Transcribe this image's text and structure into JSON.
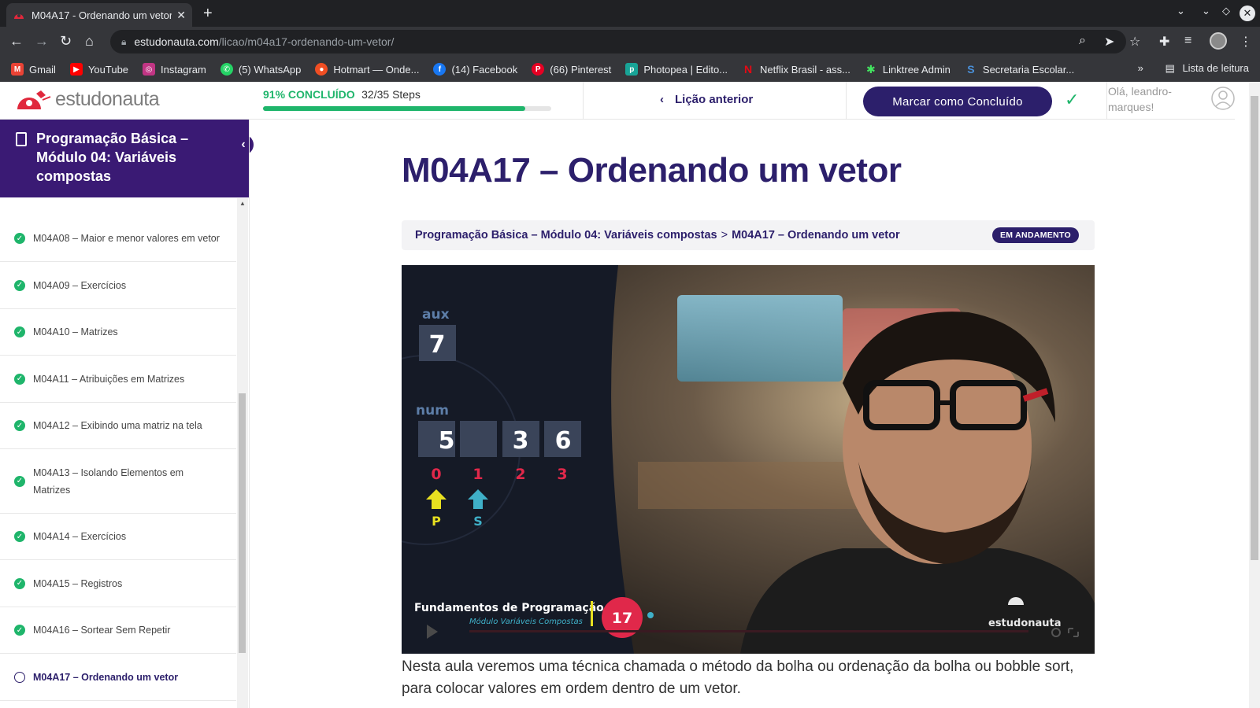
{
  "browser": {
    "tab_title": "M04A17 - Ordenando um vetor",
    "new_tab": "+",
    "url_domain": "estudonauta.com",
    "url_path": "/licao/m04a17-ordenando-um-vetor/",
    "bookmarks": [
      {
        "label": "Gmail",
        "icon": "gmail-icon",
        "color": "#ea4335",
        "glyph": "M"
      },
      {
        "label": "YouTube",
        "icon": "youtube-icon",
        "color": "#ff0000",
        "glyph": "▶"
      },
      {
        "label": "Instagram",
        "icon": "instagram-icon",
        "color": "#c13584",
        "glyph": "◎"
      },
      {
        "label": "(5) WhatsApp",
        "icon": "whatsapp-icon",
        "color": "#25d366",
        "glyph": "✆"
      },
      {
        "label": "Hotmart — Onde...",
        "icon": "hotmart-icon",
        "color": "#f04e23",
        "glyph": "●"
      },
      {
        "label": "(14) Facebook",
        "icon": "facebook-icon",
        "color": "#1877f2",
        "glyph": "f"
      },
      {
        "label": "(66) Pinterest",
        "icon": "pinterest-icon",
        "color": "#e60023",
        "glyph": "P"
      },
      {
        "label": "Photopea | Edito...",
        "icon": "photopea-icon",
        "color": "#18a497",
        "glyph": "p"
      },
      {
        "label": "Netflix Brasil - ass...",
        "icon": "netflix-icon",
        "color": "#e50914",
        "glyph": "N"
      },
      {
        "label": "Linktree Admin",
        "icon": "linktree-icon",
        "color": "#43e660",
        "glyph": "✱"
      },
      {
        "label": "Secretaria Escolar...",
        "icon": "secretaria-icon",
        "color": "#4a90d9",
        "glyph": "S"
      }
    ],
    "more": "»",
    "reading_list": "Lista de leitura"
  },
  "header": {
    "logo_text": "estudonauta",
    "progress_pct": "91% CONCLUÍDO",
    "progress_steps": "32/35 Steps",
    "progress_fraction": 0.91,
    "prev_lesson": "Lição anterior",
    "mark_complete": "Marcar como Concluído",
    "greeting": "Olá, leandro-marques!"
  },
  "sidebar": {
    "course_title": "Programação Básica – Módulo 04: Variáveis compostas",
    "lessons": [
      {
        "label": "M04A08 – Maior e menor valores em vetor",
        "done": true
      },
      {
        "label": "M04A09 – Exercícios",
        "done": true
      },
      {
        "label": "M04A10 – Matrizes",
        "done": true
      },
      {
        "label": "M04A11 – Atribuições em Matrizes",
        "done": true
      },
      {
        "label": "M04A12 – Exibindo uma matriz na tela",
        "done": true
      },
      {
        "label": "M04A13 – Isolando Elementos em Matrizes",
        "done": true
      },
      {
        "label": "M04A14 – Exercícios",
        "done": true
      },
      {
        "label": "M04A15 – Registros",
        "done": true
      },
      {
        "label": "M04A16 – Sortear Sem Repetir",
        "done": true
      },
      {
        "label": "M04A17 – Ordenando um vetor",
        "done": false
      }
    ]
  },
  "main": {
    "title": "M04A17 – Ordenando um vetor",
    "breadcrumb_course": "Programação Básica – Módulo 04: Variáveis compostas",
    "breadcrumb_sep": ">",
    "breadcrumb_lesson": "M04A17 – Ordenando um vetor",
    "status": "EM ANDAMENTO",
    "description": "Nesta aula veremos uma técnica chamada o método da bolha ou ordenação da bolha ou bobble sort, para colocar valores em ordem dentro de um vetor."
  },
  "video": {
    "aux_label": "aux",
    "aux_value": "7",
    "num_label": "num",
    "num_values": [
      "5",
      "",
      "3",
      "6"
    ],
    "indices": [
      "0",
      "1",
      "2",
      "3"
    ],
    "pointer_p": "P",
    "pointer_s": "S",
    "series_title": "Fundamentos de Programação",
    "series_subtitle": "Módulo Variáveis Compostas",
    "episode": "17",
    "watermark": "estudonauta"
  }
}
